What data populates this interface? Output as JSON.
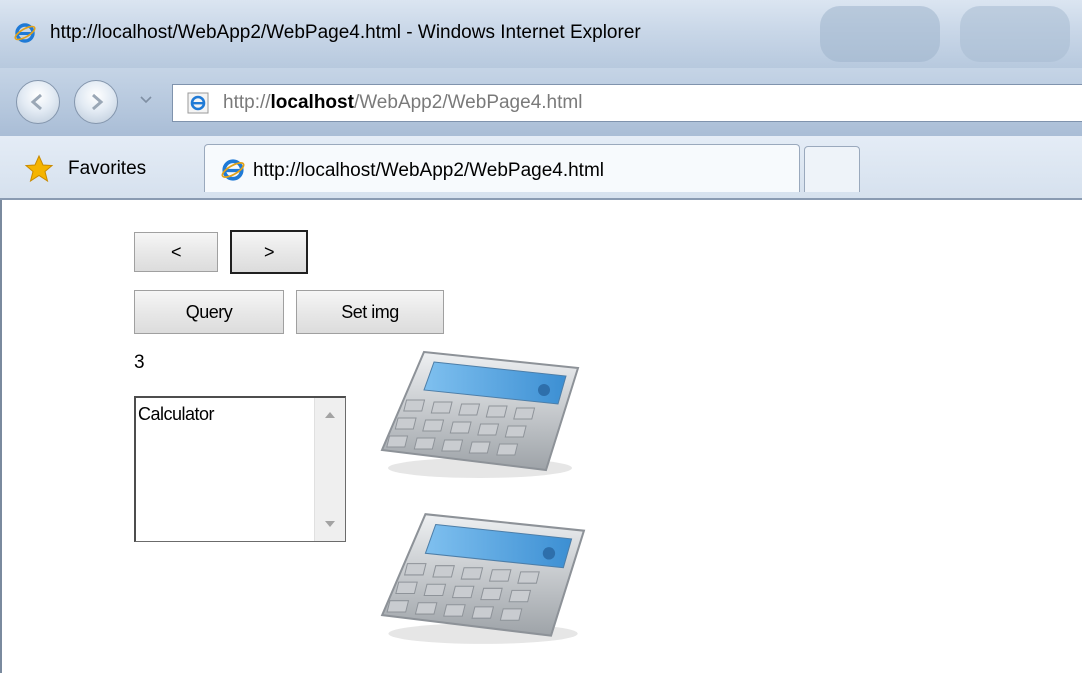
{
  "window": {
    "title": "http://localhost/WebApp2/WebPage4.html - Windows Internet Explorer"
  },
  "address_bar": {
    "prefix": "http://",
    "host": "localhost",
    "path": "/WebApp2/WebPage4.html"
  },
  "favorites_bar": {
    "favorites_label": "Favorites",
    "tab_label": "http://localhost/WebApp2/WebPage4.html"
  },
  "page": {
    "prev_button": "<",
    "next_button": ">",
    "query_button": "Query",
    "set_img_button": "Set img",
    "count": "3",
    "list_items": [
      "Calculator"
    ]
  },
  "icons": {
    "browser": "internet-explorer-icon",
    "back": "back-arrow-icon",
    "forward": "forward-arrow-icon",
    "favorites": "star-icon",
    "image": "calculator-icon"
  },
  "colors": {
    "chrome_blue": "#c5d4e6",
    "ie_blue": "#1f7ad6",
    "star_gold": "#f5b400"
  }
}
